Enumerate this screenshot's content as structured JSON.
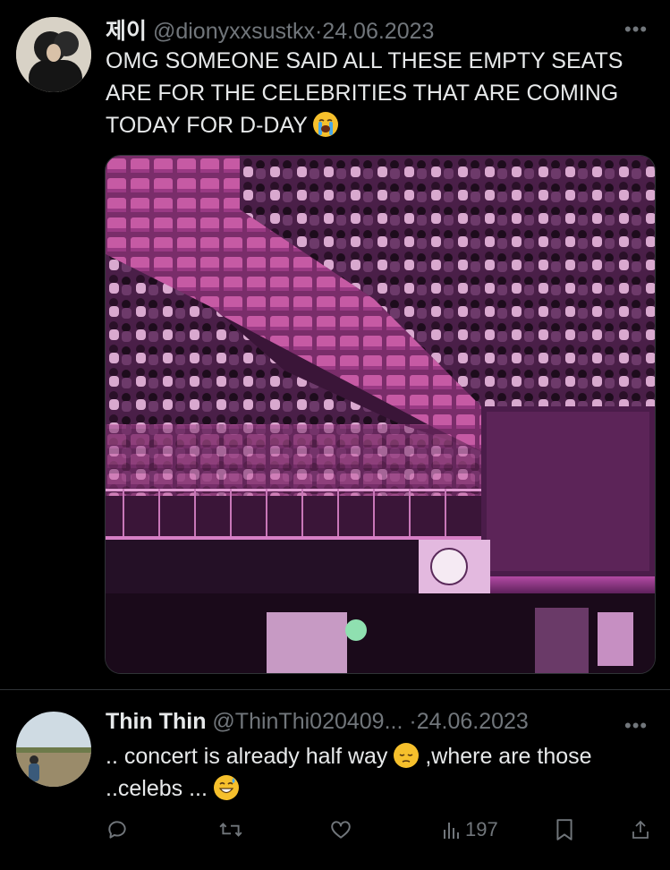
{
  "tweet1": {
    "display_name": "제이",
    "handle": "@dionyxxsustkx",
    "separator": "·",
    "date": "24.06.2023",
    "text": "OMG SOMEONE SAID ALL THESE EMPTY SEATS ARE FOR THE CELEBRITIES THAT ARE COMING TODAY FOR D-DAY",
    "emoji": "loudly-crying-face",
    "more": "•••"
  },
  "tweet2": {
    "display_name": "Thin Thin",
    "handle": "@ThinThi020409...",
    "separator": "·",
    "date": "24.06.2023",
    "text_part1": ".. concert is already half way",
    "emoji1": "pensive-face",
    "text_part2": ",where are those ..celebs ...",
    "emoji2": "grinning-sweat-face",
    "more": "•••",
    "actions": {
      "reply_icon": "reply-icon",
      "retweet_icon": "retweet-icon",
      "like_icon": "heart-icon",
      "views_icon": "views-icon",
      "views_count": "197",
      "bookmark_icon": "bookmark-icon",
      "share_icon": "share-icon"
    }
  },
  "colors": {
    "background": "#000000",
    "text_primary": "#e7e9ea",
    "text_secondary": "#71767b",
    "divider": "#2f3336",
    "stadium_seat": "#c0509c"
  }
}
